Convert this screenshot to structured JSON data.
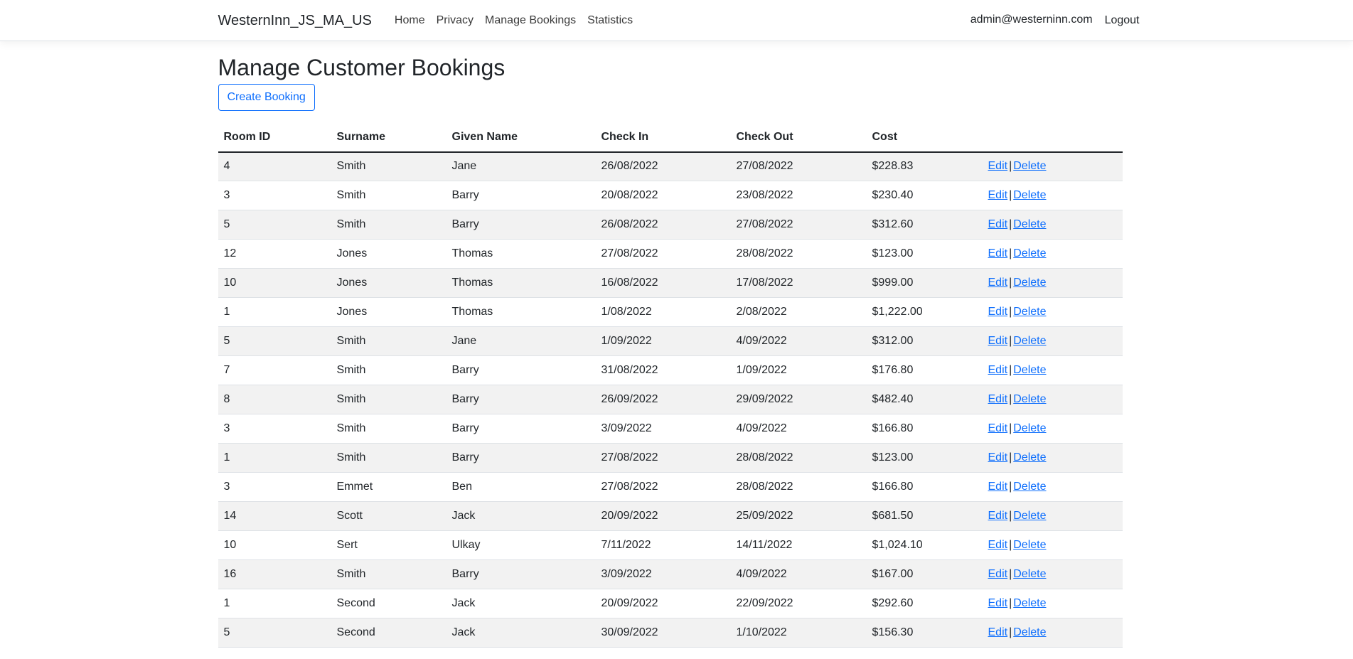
{
  "navbar": {
    "brand": "WesternInn_JS_MA_US",
    "links": [
      {
        "label": "Home"
      },
      {
        "label": "Privacy"
      },
      {
        "label": "Manage Bookings"
      },
      {
        "label": "Statistics"
      }
    ],
    "user_email": "admin@westerninn.com",
    "logout_label": "Logout"
  },
  "page": {
    "title": "Manage Customer Bookings",
    "create_button": "Create Booking"
  },
  "table": {
    "headers": [
      "Room ID",
      "Surname",
      "Given Name",
      "Check In",
      "Check Out",
      "Cost",
      ""
    ],
    "edit_label": "Edit",
    "separator": "|",
    "delete_label": "Delete",
    "rows": [
      {
        "room_id": "4",
        "surname": "Smith",
        "given_name": "Jane",
        "check_in": "26/08/2022",
        "check_out": "27/08/2022",
        "cost": "$228.83"
      },
      {
        "room_id": "3",
        "surname": "Smith",
        "given_name": "Barry",
        "check_in": "20/08/2022",
        "check_out": "23/08/2022",
        "cost": "$230.40"
      },
      {
        "room_id": "5",
        "surname": "Smith",
        "given_name": "Barry",
        "check_in": "26/08/2022",
        "check_out": "27/08/2022",
        "cost": "$312.60"
      },
      {
        "room_id": "12",
        "surname": "Jones",
        "given_name": "Thomas",
        "check_in": "27/08/2022",
        "check_out": "28/08/2022",
        "cost": "$123.00"
      },
      {
        "room_id": "10",
        "surname": "Jones",
        "given_name": "Thomas",
        "check_in": "16/08/2022",
        "check_out": "17/08/2022",
        "cost": "$999.00"
      },
      {
        "room_id": "1",
        "surname": "Jones",
        "given_name": "Thomas",
        "check_in": "1/08/2022",
        "check_out": "2/08/2022",
        "cost": "$1,222.00"
      },
      {
        "room_id": "5",
        "surname": "Smith",
        "given_name": "Jane",
        "check_in": "1/09/2022",
        "check_out": "4/09/2022",
        "cost": "$312.00"
      },
      {
        "room_id": "7",
        "surname": "Smith",
        "given_name": "Barry",
        "check_in": "31/08/2022",
        "check_out": "1/09/2022",
        "cost": "$176.80"
      },
      {
        "room_id": "8",
        "surname": "Smith",
        "given_name": "Barry",
        "check_in": "26/09/2022",
        "check_out": "29/09/2022",
        "cost": "$482.40"
      },
      {
        "room_id": "3",
        "surname": "Smith",
        "given_name": "Barry",
        "check_in": "3/09/2022",
        "check_out": "4/09/2022",
        "cost": "$166.80"
      },
      {
        "room_id": "1",
        "surname": "Smith",
        "given_name": "Barry",
        "check_in": "27/08/2022",
        "check_out": "28/08/2022",
        "cost": "$123.00"
      },
      {
        "room_id": "3",
        "surname": "Emmet",
        "given_name": "Ben",
        "check_in": "27/08/2022",
        "check_out": "28/08/2022",
        "cost": "$166.80"
      },
      {
        "room_id": "14",
        "surname": "Scott",
        "given_name": "Jack",
        "check_in": "20/09/2022",
        "check_out": "25/09/2022",
        "cost": "$681.50"
      },
      {
        "room_id": "10",
        "surname": "Sert",
        "given_name": "Ulkay",
        "check_in": "7/11/2022",
        "check_out": "14/11/2022",
        "cost": "$1,024.10"
      },
      {
        "room_id": "16",
        "surname": "Smith",
        "given_name": "Barry",
        "check_in": "3/09/2022",
        "check_out": "4/09/2022",
        "cost": "$167.00"
      },
      {
        "room_id": "1",
        "surname": "Second",
        "given_name": "Jack",
        "check_in": "20/09/2022",
        "check_out": "22/09/2022",
        "cost": "$292.60"
      },
      {
        "room_id": "5",
        "surname": "Second",
        "given_name": "Jack",
        "check_in": "30/09/2022",
        "check_out": "1/10/2022",
        "cost": "$156.30"
      }
    ]
  },
  "colors": {
    "link": "#0d6efd",
    "text": "#212529",
    "stripe": "#f2f2f2",
    "row_border": "#dee2e6"
  }
}
